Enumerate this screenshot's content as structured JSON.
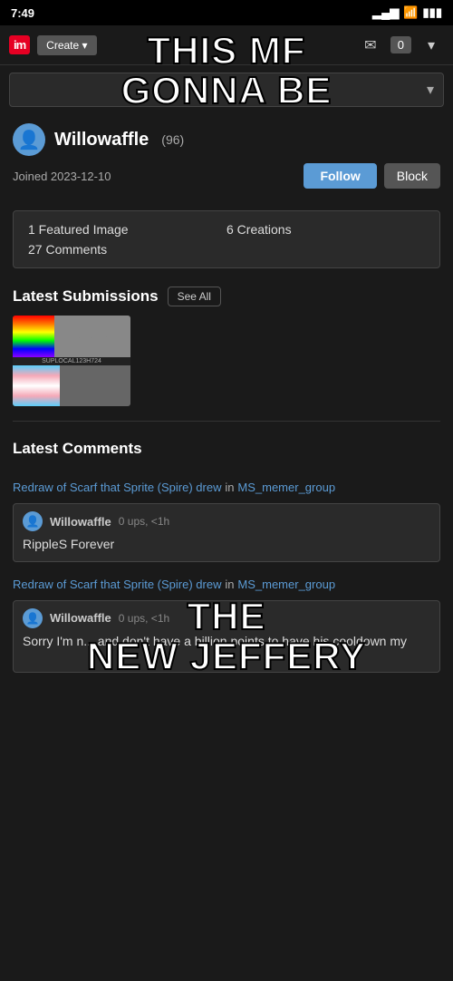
{
  "statusBar": {
    "time": "7:49",
    "signal": "▂▄▆",
    "wifi": "WiFi",
    "battery": "🔋"
  },
  "memeText": {
    "line1": "THIS MF",
    "line2": "GONNA BE",
    "line3": "THE",
    "line4": "NEW JEFFERY"
  },
  "nav": {
    "logo": "im",
    "createLabel": "Create ▾",
    "notifCount": "0"
  },
  "profile": {
    "username": "Willowaffle",
    "points": "(96)",
    "joinDate": "Joined 2023-12-10",
    "followLabel": "Follow",
    "blockLabel": "Block"
  },
  "stats": {
    "featuredImages": "1 Featured Image",
    "creations": "6 Creations",
    "comments": "27 Comments"
  },
  "submissions": {
    "title": "Latest Submissions",
    "seeAllLabel": "See All"
  },
  "latestComments": {
    "title": "Latest Comments",
    "comment1": {
      "linkText": "Redraw of Scarf that Sprite (Spire) drew",
      "inText": "in",
      "group": "MS_memer_group",
      "user": "Willowaffle",
      "meta": "0 ups, <1h",
      "text": "RippleS Forever"
    },
    "comment2": {
      "linkText": "Redraw of Scarf that Sprite (Spire) drew",
      "inText": "in",
      "group": "MS_memer_group",
      "user": "Willowaffle",
      "meta": "0 ups, <1h",
      "text": "Sorry I'm n... and don't have a billion points to have his cooldown my"
    }
  }
}
